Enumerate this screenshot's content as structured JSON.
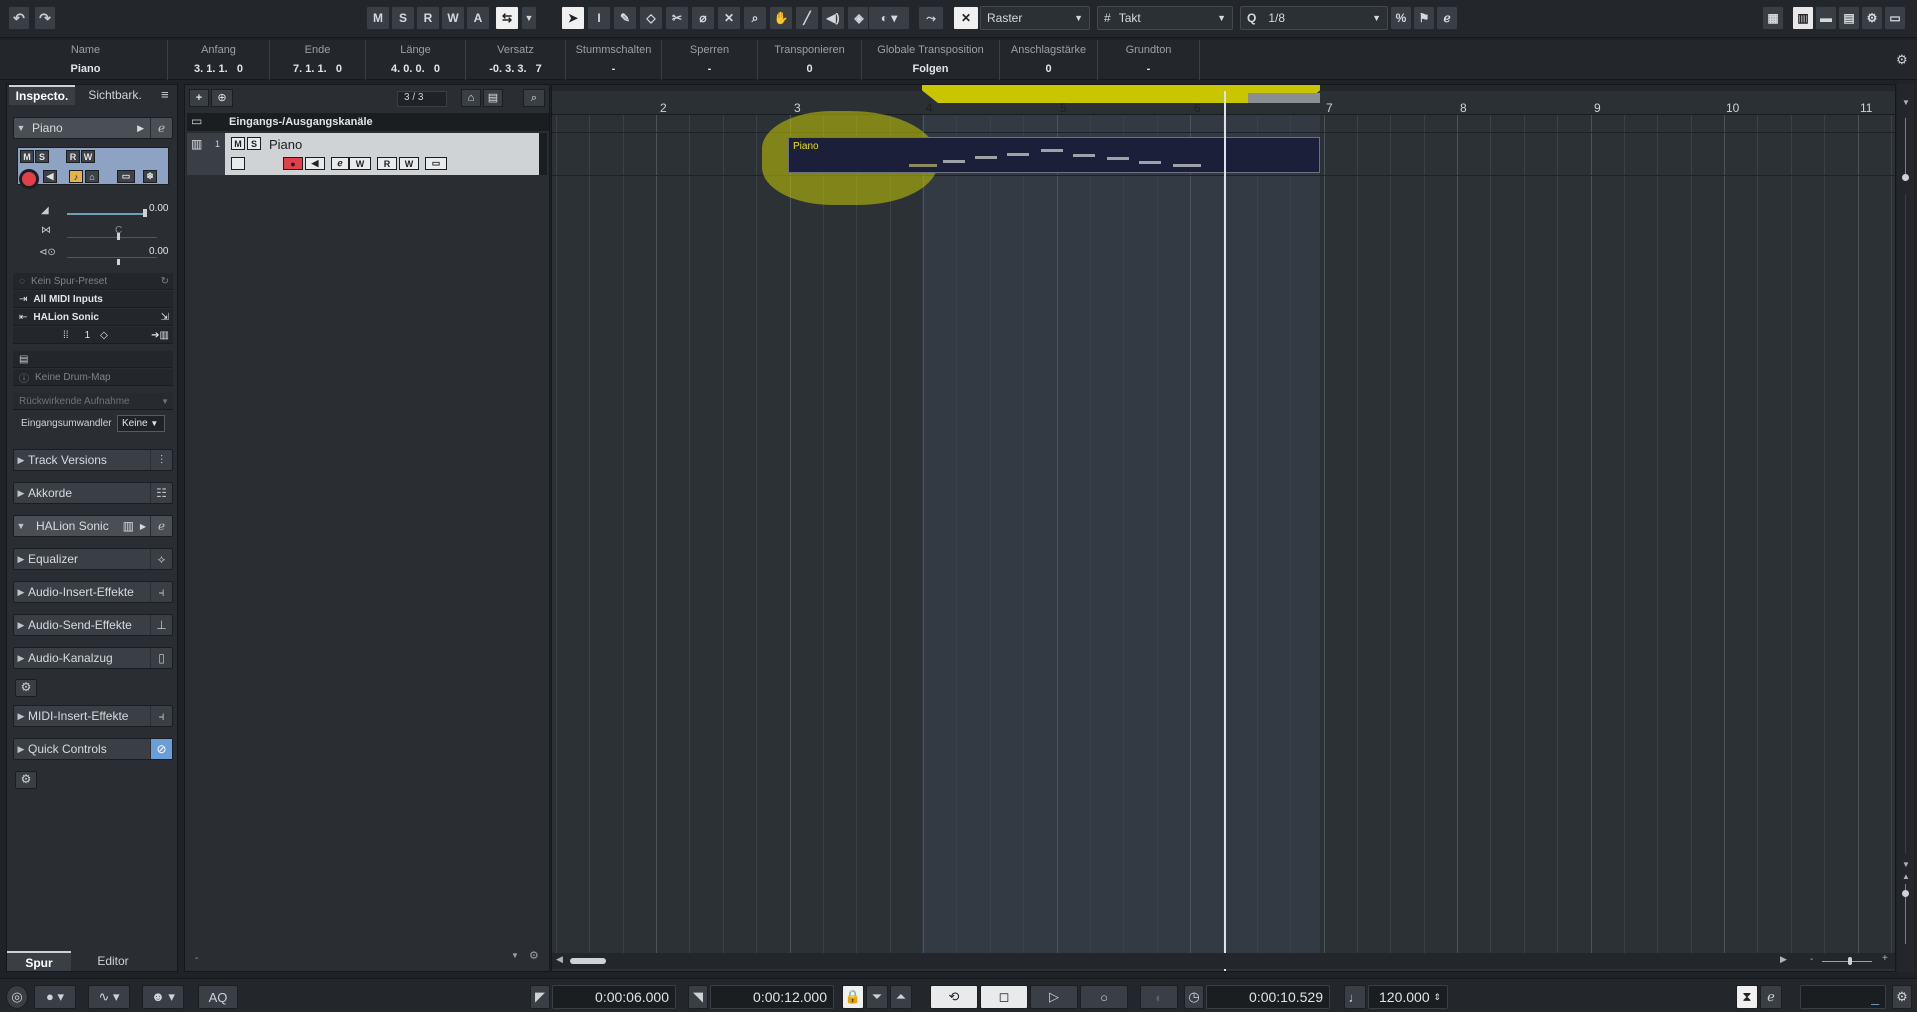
{
  "toolbar": {
    "undo_icon": "undo-icon",
    "redo_icon": "redo-icon",
    "mode_buttons": [
      "M",
      "S",
      "R",
      "W",
      "A"
    ],
    "snap_label": "Raster",
    "grid_label": "Takt",
    "quantize_label": "1/8"
  },
  "infoline": {
    "columns": [
      {
        "label": "Name",
        "value": "Piano"
      },
      {
        "label": "Anfang",
        "value": "3. 1. 1.   0"
      },
      {
        "label": "Ende",
        "value": "7. 1. 1.   0"
      },
      {
        "label": "Länge",
        "value": "4. 0. 0.   0"
      },
      {
        "label": "Versatz",
        "value": "-0. 3. 3.   7"
      },
      {
        "label": "Stummschalten",
        "value": "-"
      },
      {
        "label": "Sperren",
        "value": "-"
      },
      {
        "label": "Transponieren",
        "value": "0"
      },
      {
        "label": "Globale Transposition",
        "value": "Folgen"
      },
      {
        "label": "Anschlagstärke",
        "value": "0"
      },
      {
        "label": "Grundton",
        "value": "-"
      }
    ]
  },
  "inspector": {
    "tabs": [
      "Inspecto.",
      "Sichtbark."
    ],
    "track_name": "Piano",
    "volume": "0.00",
    "pan_label": "C",
    "pan_value": "0.00",
    "preset": "Kein Spur-Preset",
    "input": "All MIDI Inputs",
    "output": "HALion Sonic",
    "channel": "1",
    "drum_map": "Keine Drum-Map",
    "retro_record": "Rückwirkende Aufnahme",
    "input_transformer_label": "Eingangsumwandler",
    "input_transformer_value": "Keine",
    "sections": [
      "Track Versions",
      "Akkorde",
      "HALion Sonic",
      "Equalizer",
      "Audio-Insert-Effekte",
      "Audio-Send-Effekte",
      "Audio-Kanalzug",
      "MIDI-Insert-Effekte",
      "Quick Controls"
    ],
    "bottom_tabs": [
      "Spur",
      "Editor"
    ]
  },
  "tracklist": {
    "count": "3 / 3",
    "folder_name": "Eingangs-/Ausgangskanäle",
    "track_number": "1",
    "track_name": "Piano"
  },
  "arrange": {
    "bars": [
      "2",
      "3",
      "4",
      "5",
      "6",
      "7",
      "8",
      "9",
      "10",
      "11"
    ],
    "part_name": "Piano"
  },
  "transport": {
    "left_locator": "0:00:06.000",
    "right_locator": "0:00:12.000",
    "position": "0:00:10.529",
    "tempo": "120.000",
    "aq_label": "AQ"
  },
  "colors": {
    "accent_yellow": "#e6e000",
    "record_red": "#e0404a",
    "part_bg": "#1c1f3a"
  }
}
